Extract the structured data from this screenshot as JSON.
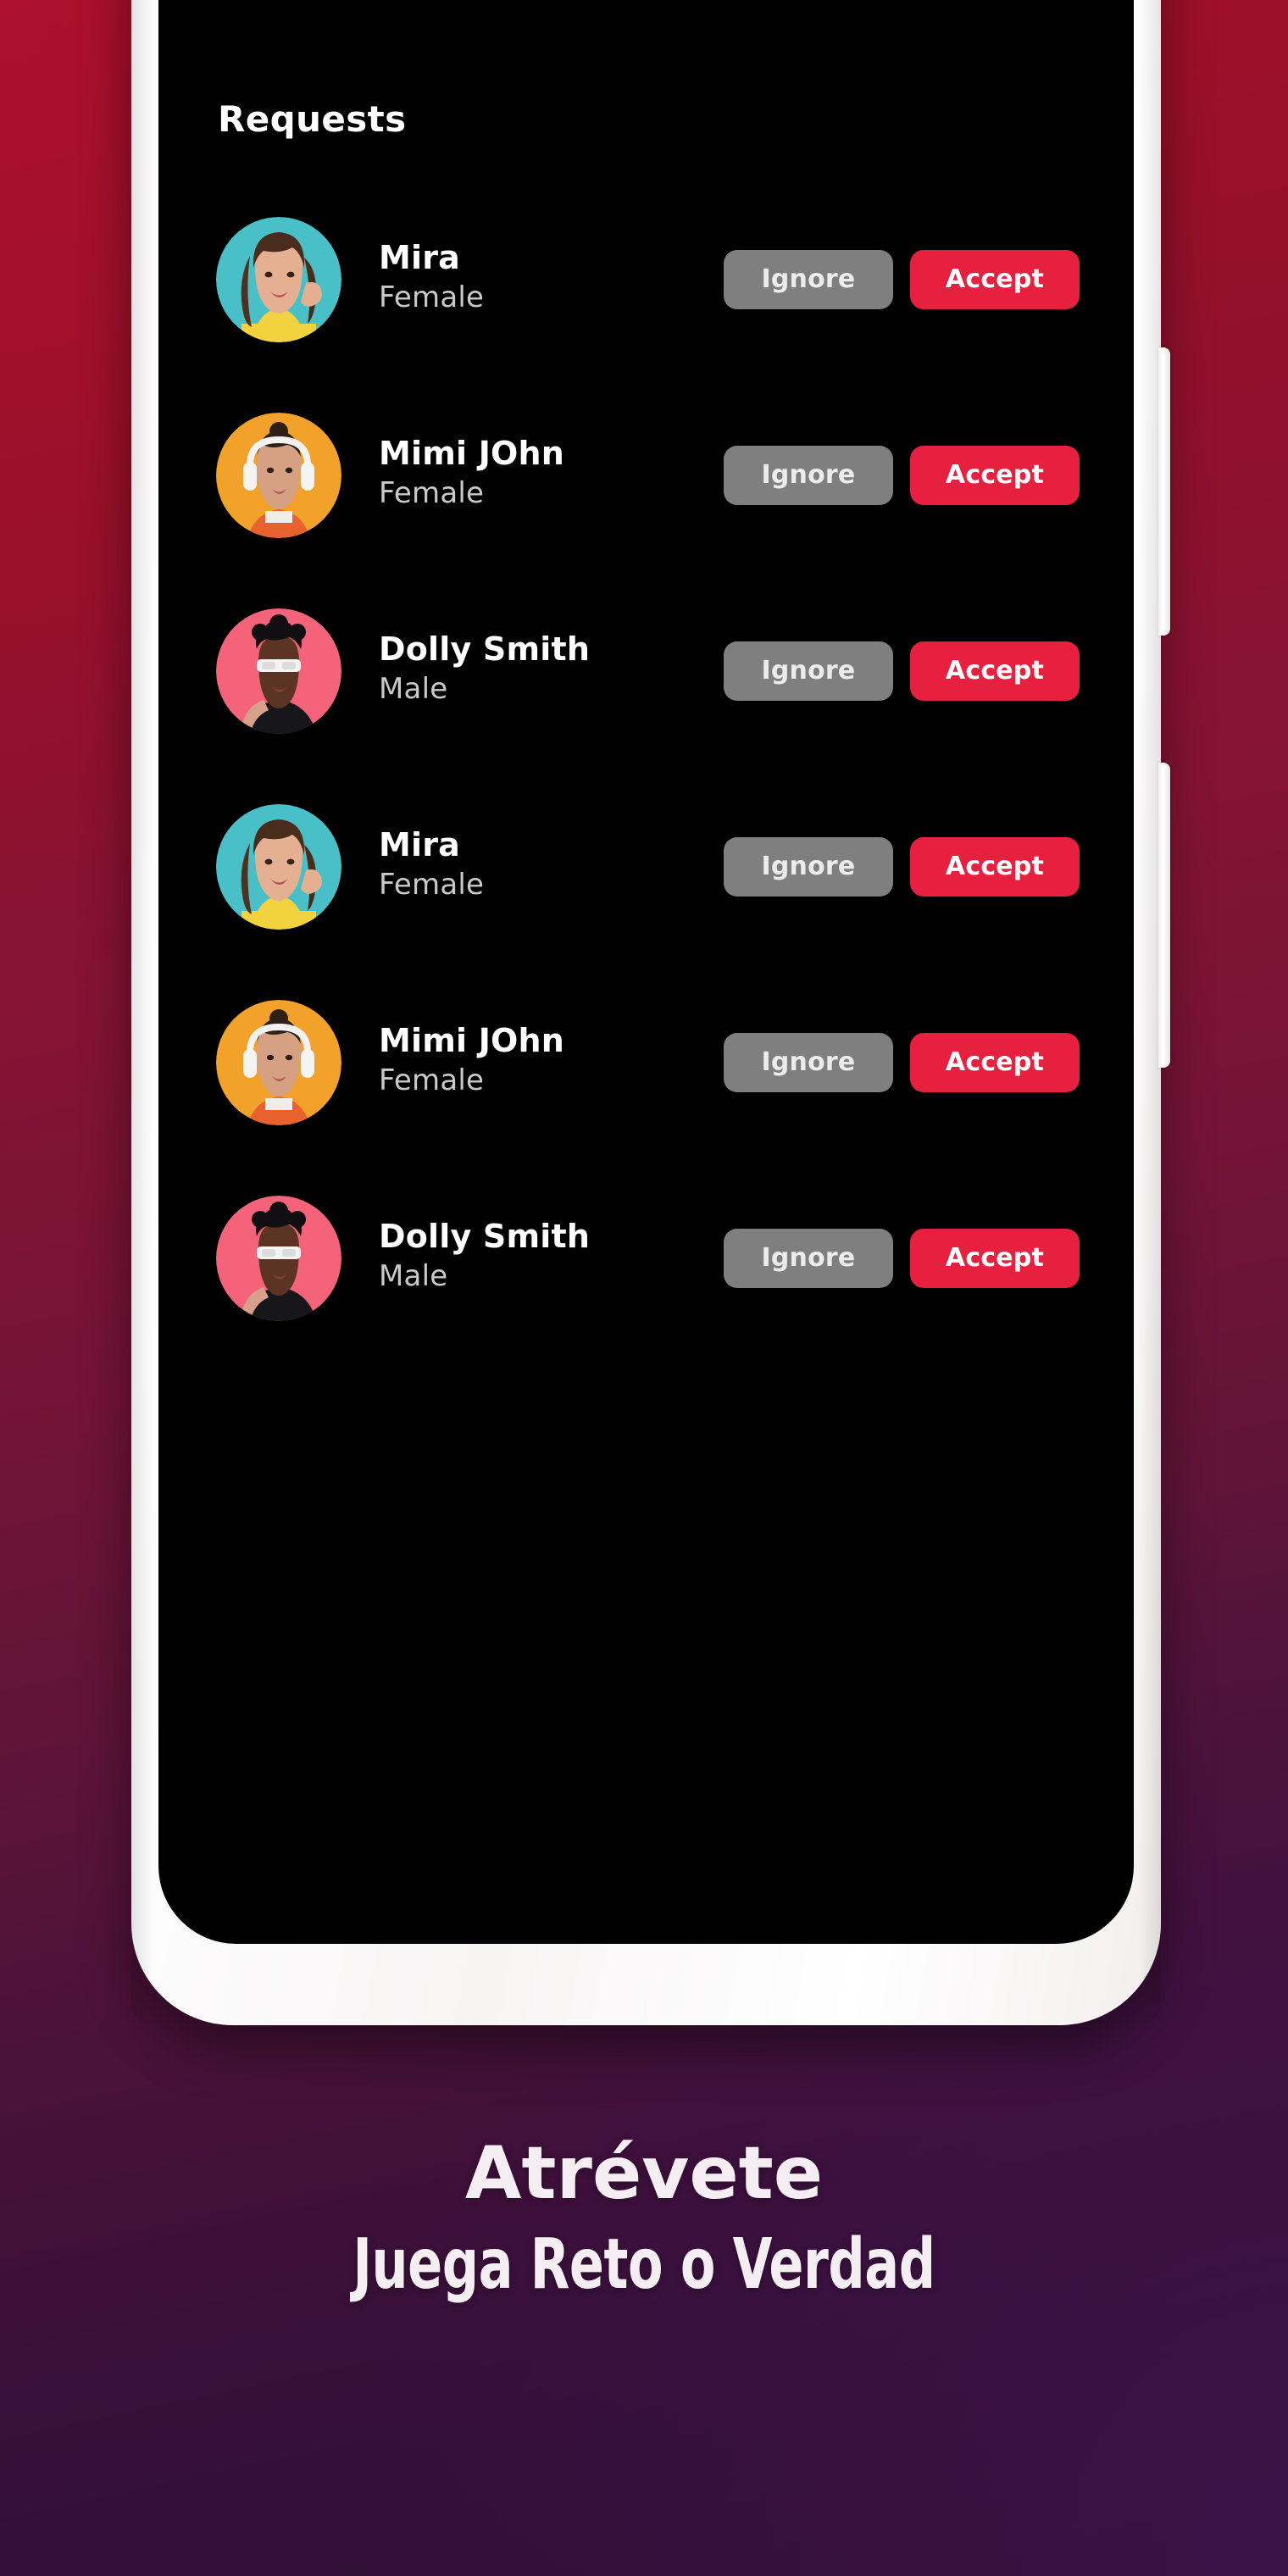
{
  "background": {
    "gradient_start": "#a8102b",
    "gradient_end": "#2d0f33"
  },
  "phone": {
    "frame_color": "#ffffff",
    "screen_color": "#000000",
    "side_buttons": [
      "volume-button",
      "power-button"
    ]
  },
  "screen": {
    "title": "Requests",
    "requests": [
      {
        "name": "Mira",
        "gender": "Female",
        "avatar_bg": "#49c0c8",
        "avatar_kind": "woman-hand-to-ear",
        "ignore_label": "Ignore",
        "accept_label": "Accept"
      },
      {
        "name": "Mimi JOhn",
        "gender": "Female",
        "avatar_bg": "#f2a12b",
        "avatar_kind": "woman-headphones",
        "ignore_label": "Ignore",
        "accept_label": "Accept"
      },
      {
        "name": "Dolly Smith",
        "gender": "Male",
        "avatar_bg": "#f4637a",
        "avatar_kind": "person-sunglasses",
        "ignore_label": "Ignore",
        "accept_label": "Accept"
      },
      {
        "name": "Mira",
        "gender": "Female",
        "avatar_bg": "#49c0c8",
        "avatar_kind": "woman-hand-to-ear",
        "ignore_label": "Ignore",
        "accept_label": "Accept"
      },
      {
        "name": "Mimi JOhn",
        "gender": "Female",
        "avatar_bg": "#f2a12b",
        "avatar_kind": "woman-headphones",
        "ignore_label": "Ignore",
        "accept_label": "Accept"
      },
      {
        "name": "Dolly Smith",
        "gender": "Male",
        "avatar_bg": "#f4637a",
        "avatar_kind": "person-sunglasses",
        "ignore_label": "Ignore",
        "accept_label": "Accept"
      }
    ],
    "accept_color": "#e8203f",
    "ignore_color": "#7f7f7f"
  },
  "promo": {
    "line1": "Atrévete",
    "line2": "Juega Reto o Verdad"
  }
}
